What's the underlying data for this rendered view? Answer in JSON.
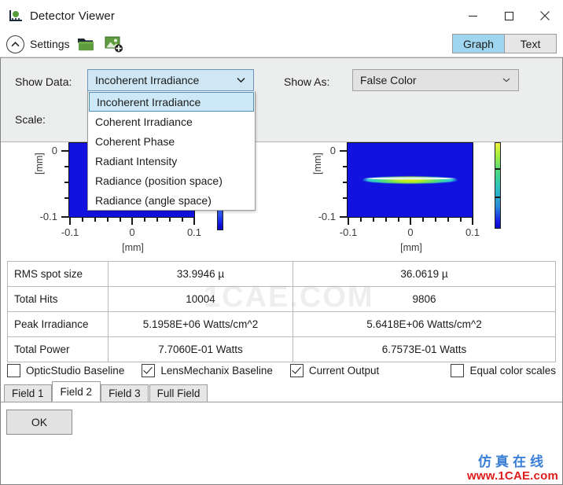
{
  "window": {
    "title": "Detector Viewer",
    "icon": "detector-icon",
    "minimize_label": "–",
    "maximize_label": "□",
    "close_label": "✕"
  },
  "toolbar": {
    "settings_label": "Settings",
    "collapse_icon": "chevron-up-circle-icon",
    "open_file_icon": "green-folder-icon",
    "save_image_icon": "add-image-icon",
    "view_modes": [
      {
        "label": "Graph",
        "active": true
      },
      {
        "label": "Text",
        "active": false
      }
    ]
  },
  "settings": {
    "show_data": {
      "label": "Show Data:",
      "value": "Incoherent Irradiance",
      "expanded": true,
      "options": [
        "Incoherent Irradiance",
        "Coherent Irradiance",
        "Coherent Phase",
        "Radiant Intensity",
        "Radiance (position space)",
        "Radiance (angle space)"
      ],
      "selected_index": 0
    },
    "show_as": {
      "label": "Show As:",
      "value": "False Color"
    },
    "scale": {
      "label": "Scale:"
    }
  },
  "chart_data": [
    {
      "type": "heatmap",
      "name": "left-detector-plot",
      "xlabel": "[mm]",
      "ylabel": "[mm]",
      "xticks": [
        "-0.1",
        "0",
        "0.1"
      ],
      "yticks": [
        "0",
        "-0.1"
      ],
      "xlim": [
        -0.1,
        0.1
      ],
      "ylim": [
        -0.1,
        0.1
      ],
      "colormap": "false-color",
      "colorbar_range_low": "blue",
      "colorbar_range_high": "blue",
      "description": "Uniform low-irradiance blue field; detail obscured by open dropdown"
    },
    {
      "type": "heatmap",
      "name": "right-detector-plot",
      "xlabel": "[mm]",
      "ylabel": "[mm]",
      "xticks": [
        "-0.1",
        "0",
        "0.1"
      ],
      "yticks": [
        "0",
        "-0.1"
      ],
      "xlim": [
        -0.1,
        0.1
      ],
      "ylim": [
        -0.1,
        0.1
      ],
      "colormap": "false-color",
      "colorbar_range_low": "blue",
      "colorbar_range_high": "yellow",
      "description": "Thin horizontal curved streak centered at y=0 spanning roughly x=-0.06 to 0.07, peaking green-yellow at center"
    }
  ],
  "results_table": {
    "rows": [
      {
        "label": "RMS spot size",
        "v1": "33.9946 µ",
        "v2": "36.0619 µ"
      },
      {
        "label": "Total Hits",
        "v1": "10004",
        "v2": "9806"
      },
      {
        "label": "Peak Irradiance",
        "v1": "5.1958E+06 Watts/cm^2",
        "v2": "5.6418E+06 Watts/cm^2"
      },
      {
        "label": "Total Power",
        "v1": "7.7060E-01 Watts",
        "v2": "6.7573E-01 Watts"
      }
    ]
  },
  "checkboxes": [
    {
      "label": "OpticStudio Baseline",
      "checked": false
    },
    {
      "label": "LensMechanix Baseline",
      "checked": true
    },
    {
      "label": "Current Output",
      "checked": true
    },
    {
      "label": "Equal color scales",
      "checked": false
    }
  ],
  "tabs": [
    {
      "label": "Field 1",
      "active": false
    },
    {
      "label": "Field 2",
      "active": true
    },
    {
      "label": "Field 3",
      "active": false
    },
    {
      "label": "Full Field",
      "active": false
    }
  ],
  "footer": {
    "ok_label": "OK"
  },
  "watermark": {
    "plot_text": "1CAE.COM",
    "corner_cn": "仿真在线",
    "corner_url": "www.1CAE.com"
  },
  "colors": {
    "accent": "#9fd5ef",
    "combo_active": "#cfe7f5",
    "panel": "#eceded",
    "heat_low": "#1212e0",
    "heat_high": "#f2f23c"
  }
}
